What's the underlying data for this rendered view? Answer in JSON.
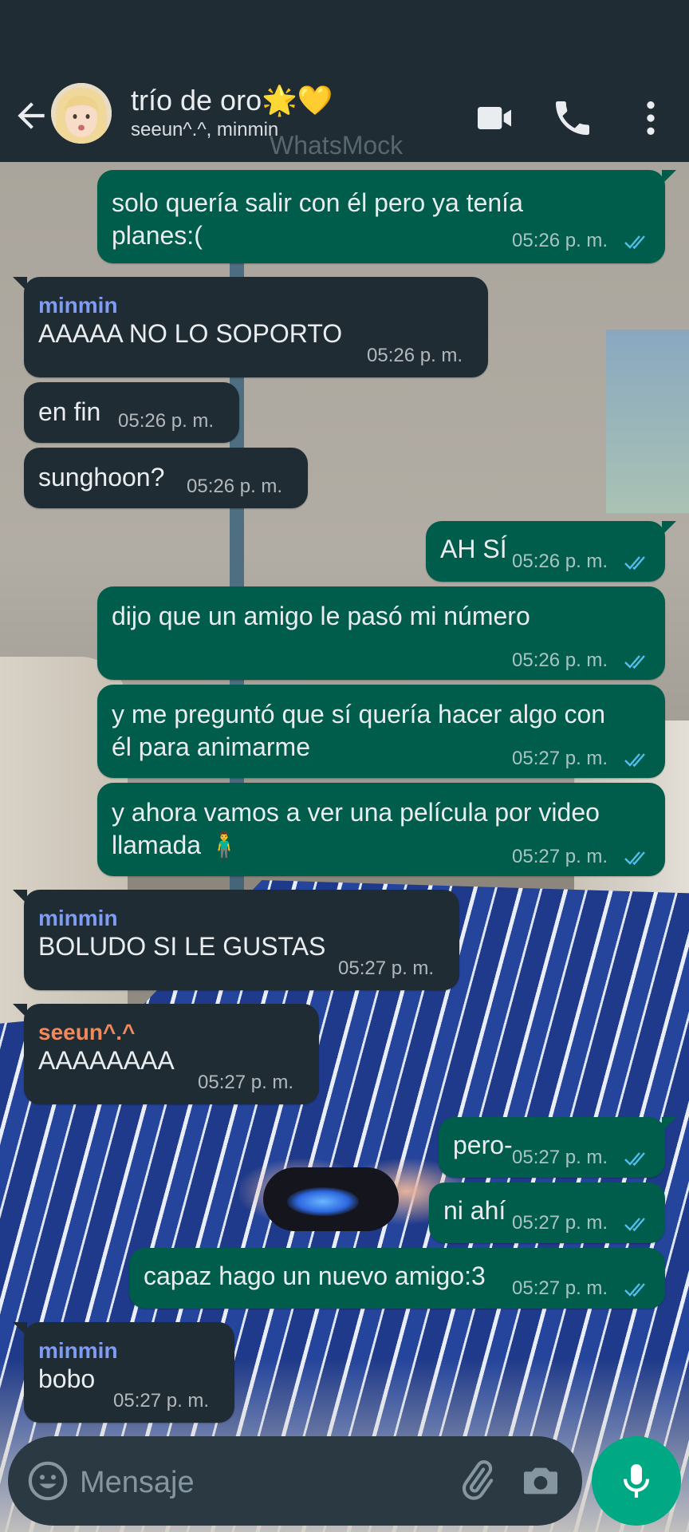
{
  "header": {
    "title": "trío de oro🌟💛",
    "subtitle": "seeun^.^, minmin",
    "watermark": "WhatsMock"
  },
  "colors": {
    "outgoing_bubble": "#005c4b",
    "incoming_bubble": "#202c33",
    "header_bg": "#1f2c34",
    "minmin_name": "#7f9cf5",
    "seeun_name": "#f08a5d",
    "read_ticks": "#53bdeb",
    "mic_button": "#00a884"
  },
  "messages": [
    {
      "dir": "out",
      "text": "solo quería salir con él pero ya tenía\nplanes:(",
      "time": "05:26 p. m."
    },
    {
      "dir": "in",
      "sender": "minmin",
      "text": "AAAAA NO LO SOPORTO",
      "time": "05:26 p. m."
    },
    {
      "dir": "in",
      "text": "en fin",
      "time": "05:26 p. m."
    },
    {
      "dir": "in",
      "text": "sunghoon?",
      "time": "05:26 p. m."
    },
    {
      "dir": "out",
      "text": "AH SÍ",
      "time": "05:26 p. m."
    },
    {
      "dir": "out",
      "text": "dijo que un amigo le pasó mi número",
      "time": "05:26 p. m."
    },
    {
      "dir": "out",
      "text": "y me preguntó que sí quería hacer algo con\nél para animarme",
      "time": "05:27 p. m."
    },
    {
      "dir": "out",
      "text": "y ahora vamos a ver una película por video\nllamada 🧍‍♂️",
      "time": "05:27 p. m."
    },
    {
      "dir": "in",
      "sender": "minmin",
      "text": "BOLUDO SI LE GUSTAS",
      "time": "05:27 p. m."
    },
    {
      "dir": "in",
      "sender": "seeun^.^",
      "text": "AAAAAAAA",
      "time": "05:27 p. m."
    },
    {
      "dir": "out",
      "text": "pero-",
      "time": "05:27 p. m."
    },
    {
      "dir": "out",
      "text": "ni ahí",
      "time": "05:27 p. m."
    },
    {
      "dir": "out",
      "text": "capaz hago un nuevo amigo:3",
      "time": "05:27 p. m."
    },
    {
      "dir": "in",
      "sender": "minmin",
      "text": "bobo",
      "time": "05:27 p. m."
    }
  ],
  "composer": {
    "placeholder": "Mensaje"
  },
  "icons": [
    "back-arrow-icon",
    "avatar",
    "video-call-icon",
    "voice-call-icon",
    "more-options-icon",
    "emoji-icon",
    "attach-icon",
    "camera-icon",
    "mic-icon",
    "double-check-icon"
  ]
}
